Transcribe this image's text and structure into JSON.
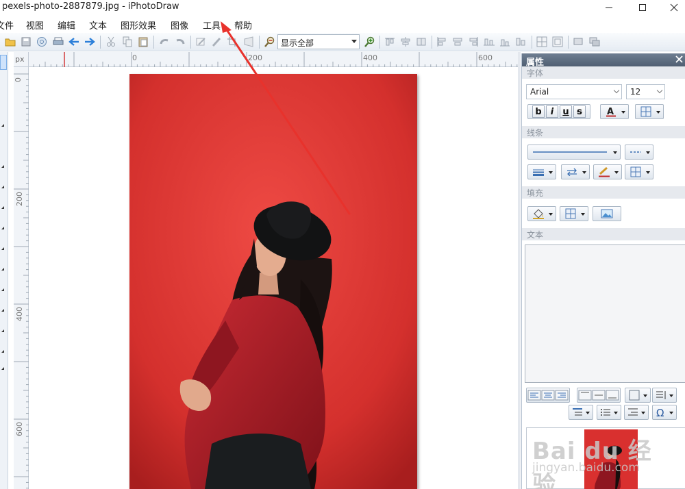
{
  "window": {
    "title": "pexels-photo-2887879.jpg - iPhotoDraw"
  },
  "menu": {
    "file": "文件",
    "view": "视图",
    "edit": "编辑",
    "text": "文本",
    "shape_effects": "图形效果",
    "image": "图像",
    "tools": "工具",
    "help": "帮助"
  },
  "toolbar": {
    "zoom_value": "显示全部"
  },
  "ruler": {
    "unit": "px",
    "h_labels": [
      "0",
      "200",
      "400",
      "600"
    ],
    "v_labels": [
      "0",
      "200",
      "400",
      "600"
    ]
  },
  "properties": {
    "title": "属性",
    "font_section": "字体",
    "font_name": "Arial",
    "font_size": "12",
    "bold": "b",
    "italic": "i",
    "underline": "u",
    "strike": "s",
    "line_section": "线条",
    "fill_section": "填充",
    "text_section": "文本"
  },
  "watermark": {
    "main": "Bai du 经验",
    "sub": "jingyan.baidu.com"
  },
  "colors": {
    "photo_background": "#d9302f",
    "annotation_arrow": "#e8322c",
    "panel_header": "#5b6b7e"
  },
  "icons": [
    "open-icon",
    "save-icon",
    "globe-icon",
    "print-icon",
    "back-arrow-icon",
    "forward-arrow-icon",
    "cut-icon",
    "copy-icon",
    "paste-icon",
    "undo-icon",
    "redo-icon",
    "zoom-in-icon",
    "zoom-out-icon",
    "close-icon"
  ]
}
